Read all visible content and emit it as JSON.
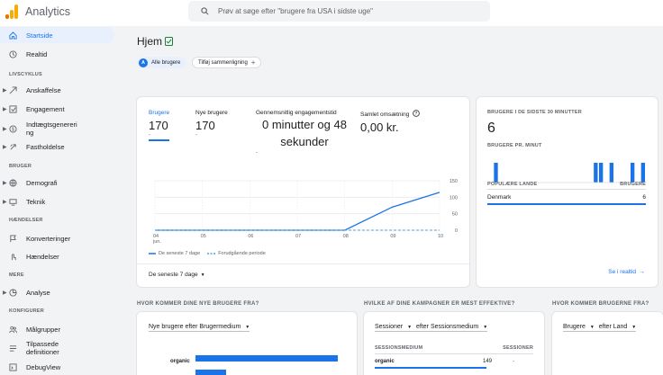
{
  "app": {
    "title": "Analytics"
  },
  "search": {
    "placeholder": "Prøv at søge efter \"brugere fra USA i sidste uge\""
  },
  "colors": {
    "accent": "#1a73e8",
    "dashed": "#4fa3e0",
    "bar": "#1a73e8"
  },
  "sidebar": {
    "home": "Startside",
    "realtime": "Realtid",
    "section_lifecycle": "LIVSCYKLUS",
    "acquisition": "Anskaffelse",
    "engagement": "Engagement",
    "monetization": "Indtægtsgenereri\nng",
    "retention": "Fastholdelse",
    "section_users": "BRUGER",
    "demographics": "Demografi",
    "tech": "Teknik",
    "section_events": "HÆNDELSER",
    "conversions": "Konverteringer",
    "events": "Hændelser",
    "section_more": "MERE",
    "analysis": "Analyse",
    "section_config": "KONFIGURER",
    "audiences": "Målgrupper",
    "custom_definitions": "Tilpassede\ndefinitioner",
    "debugview": "DebugView"
  },
  "header": {
    "title": "Hjem",
    "chip_all_badge": "A",
    "chip_all": "Alle brugere",
    "chip_add": "Tilføj sammenligning"
  },
  "overview": {
    "metrics": [
      {
        "label": "Brugere",
        "value": "170",
        "delta": "-"
      },
      {
        "label": "Nye brugere",
        "value": "170",
        "delta": "-"
      },
      {
        "label": "Gennemsnitlig engagementstid",
        "value": "0 minutter og 48 sekunder",
        "delta": "-"
      },
      {
        "label": "Samlet omsætning",
        "value": "0,00 kr.",
        "delta": ""
      }
    ],
    "date_range": "De seneste 7 dage",
    "legend_current": "De seneste 7 dage",
    "legend_previous": "Forudgående periode"
  },
  "chart_data": {
    "type": "line",
    "categories": [
      "04\njun.",
      "05",
      "06",
      "07",
      "08",
      "09",
      "10"
    ],
    "series": [
      {
        "name": "De seneste 7 dage",
        "values": [
          0,
          0,
          0,
          0,
          0,
          70,
          115
        ]
      },
      {
        "name": "Forudgående periode",
        "values": [
          0,
          0,
          0,
          0,
          0,
          0,
          0
        ]
      }
    ],
    "yticks": [
      "150",
      "100",
      "50",
      "0"
    ],
    "ylim": [
      0,
      150
    ],
    "legend_position": "bottom-left"
  },
  "realtime": {
    "title": "BRUGERE I DE SIDSTE 30 MINUTTER",
    "value": "6",
    "per_minute_label": "BRUGERE PR. MINUT",
    "per_minute": [
      0,
      1,
      0,
      0,
      0,
      0,
      0,
      0,
      0,
      0,
      0,
      0,
      0,
      0,
      0,
      0,
      0,
      0,
      0,
      0,
      1,
      1,
      0,
      1,
      0,
      0,
      0,
      1,
      0,
      1
    ],
    "col_country": "POPULÆRE LANDE",
    "col_users": "BRUGERE",
    "rows": [
      {
        "country": "Denmark",
        "users": "6"
      }
    ],
    "link": "Se i realtid"
  },
  "sections": {
    "new_users": {
      "title": "HVOR KOMMER DINE NYE BRUGERE FRA?",
      "selector": "Nye brugere efter Brugermedium",
      "row_label": "organic"
    },
    "campaigns": {
      "title": "HVILKE AF DINE KAMPAGNER ER MEST EFFEKTIVE?",
      "selector_a": "Sessioner",
      "selector_b": "efter Sessionsmedium",
      "col_a": "SESSIONSMEDIUM",
      "col_b": "SESSIONER",
      "row_label": "organic",
      "row_value": "149",
      "row_delta": "-"
    },
    "users_from": {
      "title": "HVOR KOMMER BRUGERNE FRA?",
      "selector_a": "Brugere",
      "selector_b": "efter Land"
    }
  }
}
